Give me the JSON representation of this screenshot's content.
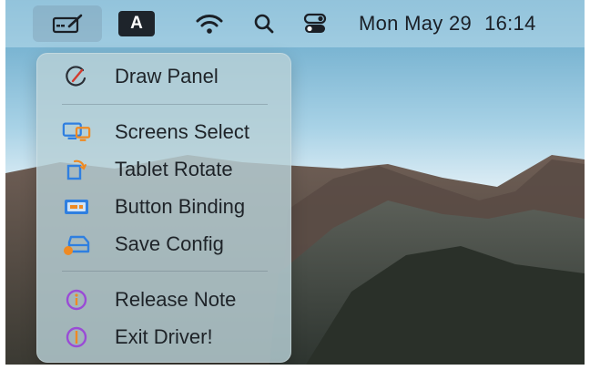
{
  "menubar": {
    "input_source": "A",
    "clock": {
      "date": "Mon May 29",
      "time": "16:14"
    }
  },
  "menu": {
    "items": [
      {
        "label": "Draw Panel"
      },
      {
        "label": "Screens Select"
      },
      {
        "label": "Tablet Rotate"
      },
      {
        "label": "Button Binding"
      },
      {
        "label": "Save Config"
      },
      {
        "label": "Release Note"
      },
      {
        "label": "Exit Driver!"
      }
    ]
  },
  "icons": {
    "menubar_tablet": "tablet-icon",
    "wifi": "wifi-icon",
    "search": "search-icon",
    "control_center": "control-center-icon",
    "draw_panel": "draw-panel-icon",
    "screens_select": "screens-icon",
    "tablet_rotate": "rotate-icon",
    "button_binding": "button-binding-icon",
    "save_config": "save-icon",
    "release_note": "info-icon",
    "exit_driver": "exit-icon"
  },
  "colors": {
    "accent_blue": "#2f7fe0",
    "accent_orange": "#ef8a23",
    "accent_purple": "#9a4bd6"
  }
}
